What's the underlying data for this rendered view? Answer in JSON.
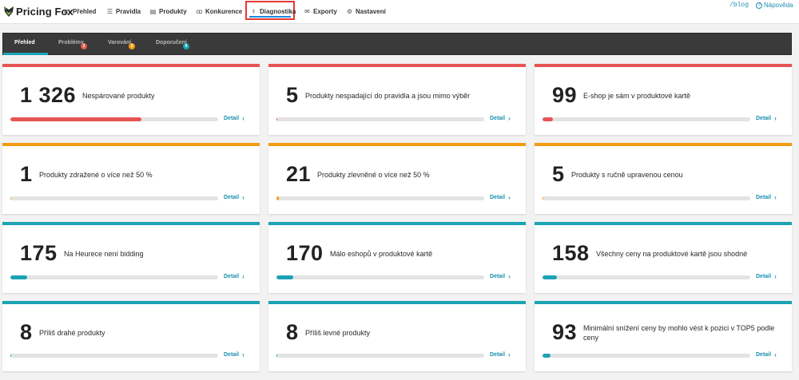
{
  "app": {
    "logo_text": "Pricing Fox",
    "blog_link": "/blog",
    "help_link": "Nápověda"
  },
  "nav": {
    "items": [
      {
        "label": "Přehled",
        "icon": "chart-icon"
      },
      {
        "label": "Pravidla",
        "icon": "rules-icon"
      },
      {
        "label": "Produkty",
        "icon": "products-icon"
      },
      {
        "label": "Konkurence",
        "icon": "competitors-icon"
      },
      {
        "label": "Diagnostika",
        "icon": "diagnostics-icon",
        "active": true
      },
      {
        "label": "Exporty",
        "icon": "export-icon"
      },
      {
        "label": "Nastavení",
        "icon": "settings-icon"
      }
    ]
  },
  "subtabs": [
    {
      "label": "Přehled",
      "active": true
    },
    {
      "label": "Problémy",
      "badge": "2",
      "badge_color": "#e05b4b"
    },
    {
      "label": "Varování",
      "badge": "3",
      "badge_color": "#f39c12"
    },
    {
      "label": "Doporučení",
      "badge": "6",
      "badge_color": "#1aa3b5"
    }
  ],
  "colors": {
    "problem": "#e85454",
    "warning": "#f39c12",
    "recommendation": "#1aa3b5",
    "link": "#1a8fb0"
  },
  "cards": [
    {
      "value": "1 326",
      "label": "Nespárované produkty",
      "detail": "Detail",
      "level": "problem",
      "progress": 0.63
    },
    {
      "value": "5",
      "label": "Produkty nespadající do pravidla a jsou mimo výběr",
      "detail": "Detail",
      "level": "problem",
      "progress": 0
    },
    {
      "value": "99",
      "label": "E-shop je sám v produktové kartě",
      "detail": "Detail",
      "level": "problem",
      "progress": 0.05
    },
    {
      "value": "1",
      "label": "Produkty zdražené o více než 50 %",
      "detail": "Detail",
      "level": "warning",
      "progress": 0
    },
    {
      "value": "21",
      "label": "Produkty zlevněné o více než 50 %",
      "detail": "Detail",
      "level": "warning",
      "progress": 0.01
    },
    {
      "value": "5",
      "label": "Produkty s ručně upravenou cenou",
      "detail": "Detail",
      "level": "warning",
      "progress": 0
    },
    {
      "value": "175",
      "label": "Na Heurece není bidding",
      "detail": "Detail",
      "level": "recommendation",
      "progress": 0.08
    },
    {
      "value": "170",
      "label": "Málo eshopů v produktové kartě",
      "detail": "Detail",
      "level": "recommendation",
      "progress": 0.08
    },
    {
      "value": "158",
      "label": "Všechny ceny na produktové kartě jsou shodné",
      "detail": "Detail",
      "level": "recommendation",
      "progress": 0.07
    },
    {
      "value": "8",
      "label": "Příliš drahé produkty",
      "detail": "Detail",
      "level": "recommendation",
      "progress": 0.004
    },
    {
      "value": "8",
      "label": "Příliš levné produkty",
      "detail": "Detail",
      "level": "recommendation",
      "progress": 0.004
    },
    {
      "value": "93",
      "label": "Minimální snížení ceny by mohlo vést k pozici v TOP5 podle ceny",
      "detail": "Detail",
      "level": "recommendation",
      "progress": 0.04
    }
  ]
}
